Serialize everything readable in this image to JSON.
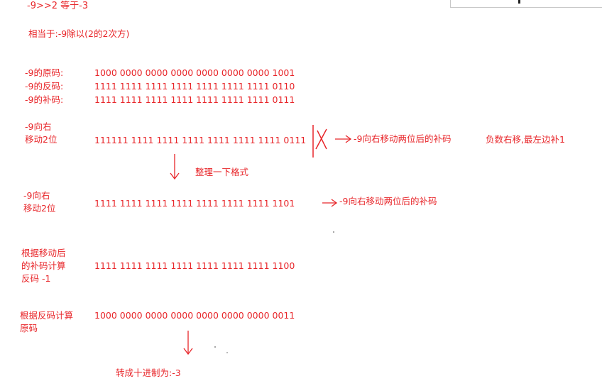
{
  "header": {
    "expr": "-9>>2  等于-3",
    "equivalent": "相当于:-9除以(2的2次方)"
  },
  "codes": [
    {
      "label": "-9的原码:",
      "bits": "1000 0000 0000 0000 0000 0000 0000 1001"
    },
    {
      "label": "-9的反码:",
      "bits": "1111 1111 1111 1111 1111 1111 1111 0110"
    },
    {
      "label": "-9的补码:",
      "bits": "1111 1111 1111 1111 1111 1111 1111 0111"
    }
  ],
  "shift1": {
    "label_lines": [
      "-9向右",
      "移动2位"
    ],
    "bits": "111111 1111 1111 1111 1111 1111 1111 01",
    "bits_struck": "11",
    "note": "-9向右移动两位后的补码",
    "side_note": "负数右移,最左边补1"
  },
  "arrange_note": "整理一下格式",
  "shift2": {
    "label_lines": [
      "-9向右",
      "移动2位"
    ],
    "bits": "1111 1111 1111 1111 1111 1111 1111 1101",
    "note": "-9向右移动两位后的补码"
  },
  "inverse": {
    "label_lines": [
      "根据移动后",
      "的补码计算",
      "反码 -1"
    ],
    "bits": "1111 1111 1111 1111 1111 1111 1111 1100"
  },
  "original": {
    "label_lines": [
      "根据反码计算",
      "原码"
    ],
    "bits": "1000 0000 0000 0000 0000 0000 0000 0011"
  },
  "result": "转成十进制为:-3",
  "colors": {
    "ink": "#e8262a",
    "background": "#ffffff"
  }
}
